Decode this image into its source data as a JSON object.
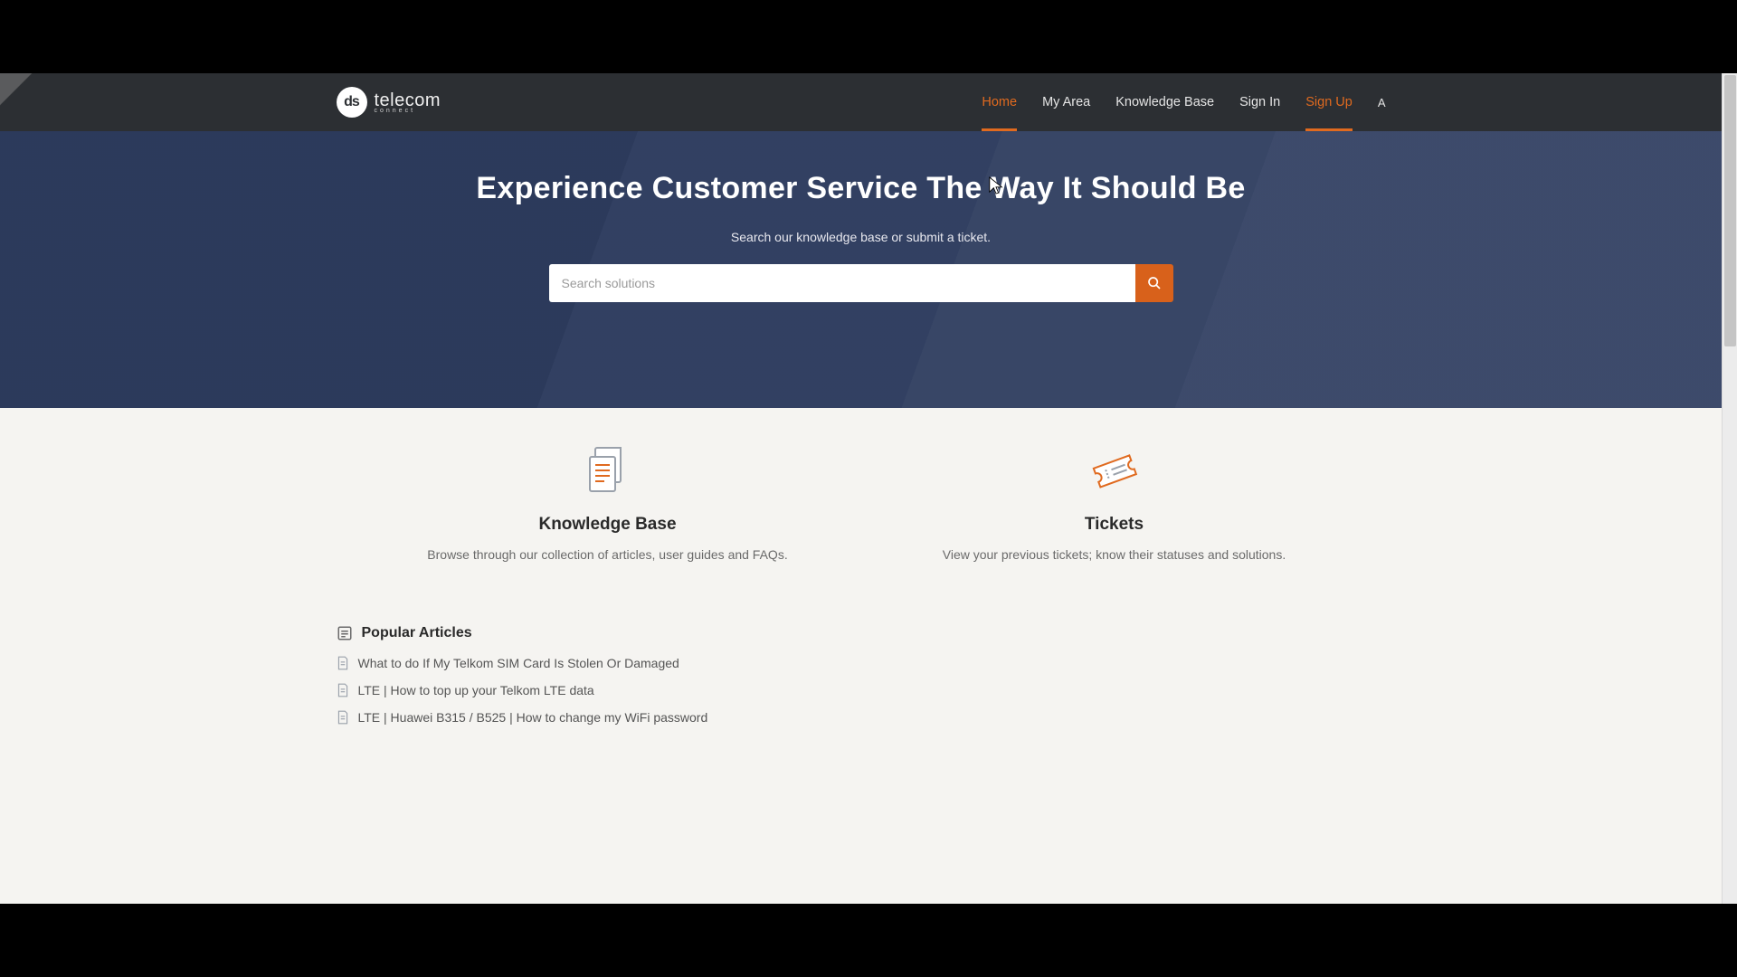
{
  "brand": {
    "mark": "ds",
    "name": "telecom",
    "tagline": "connect"
  },
  "nav": {
    "home": "Home",
    "my_area": "My Area",
    "kb": "Knowledge Base",
    "sign_in": "Sign In",
    "sign_up": "Sign Up",
    "lang": "A"
  },
  "hero": {
    "title": "Experience Customer Service The Way It Should Be",
    "subtitle": "Search our knowledge base or submit a ticket.",
    "search_placeholder": "Search solutions"
  },
  "cards": {
    "kb": {
      "title": "Knowledge Base",
      "desc": "Browse through our collection of articles, user guides and FAQs."
    },
    "tickets": {
      "title": "Tickets",
      "desc": "View your previous tickets; know their statuses and solutions."
    }
  },
  "popular": {
    "heading": "Popular Articles",
    "items": [
      "What to do If My Telkom SIM Card Is Stolen Or Damaged",
      "LTE | How to top up your Telkom LTE data",
      "LTE | Huawei B315 / B525 | How to change my WiFi password"
    ]
  },
  "colors": {
    "accent": "#e06a1f"
  }
}
